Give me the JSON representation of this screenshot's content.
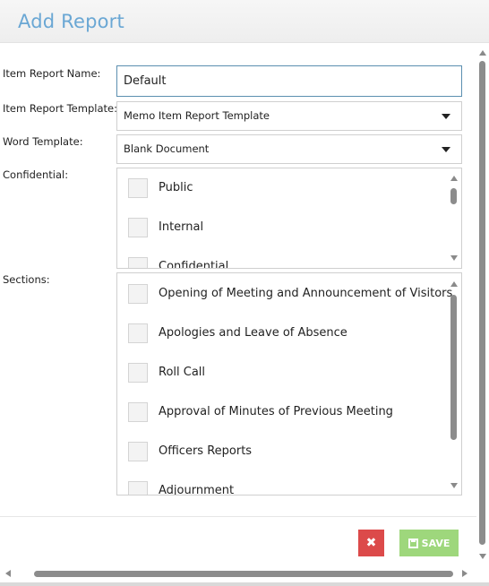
{
  "dialog": {
    "title": "Add Report"
  },
  "form": {
    "item_report_name": {
      "label": "Item Report Name:",
      "value": "Default"
    },
    "item_report_template": {
      "label": "Item Report Template:",
      "selected": "Memo Item Report Template"
    },
    "word_template": {
      "label": "Word Template:",
      "selected": "Blank Document"
    },
    "confidential": {
      "label": "Confidential:",
      "options": [
        "Public",
        "Internal",
        "Confidential"
      ]
    },
    "sections": {
      "label": "Sections:",
      "options": [
        "Opening of Meeting and Announcement of Visitors",
        "Apologies and Leave of Absence",
        "Roll Call",
        "Approval of Minutes of Previous Meeting",
        "Officers Reports",
        "Adjournment"
      ]
    }
  },
  "footer": {
    "cancel_icon": "close-icon",
    "cancel_glyph": "✖",
    "save_label": "SAVE",
    "save_icon": "floppy-disk-icon"
  },
  "colors": {
    "title": "#6aa7d4",
    "cancel_button": "#dc4a4a",
    "save_button": "#9ed77c",
    "input_focus_border": "#5b8fb0"
  }
}
